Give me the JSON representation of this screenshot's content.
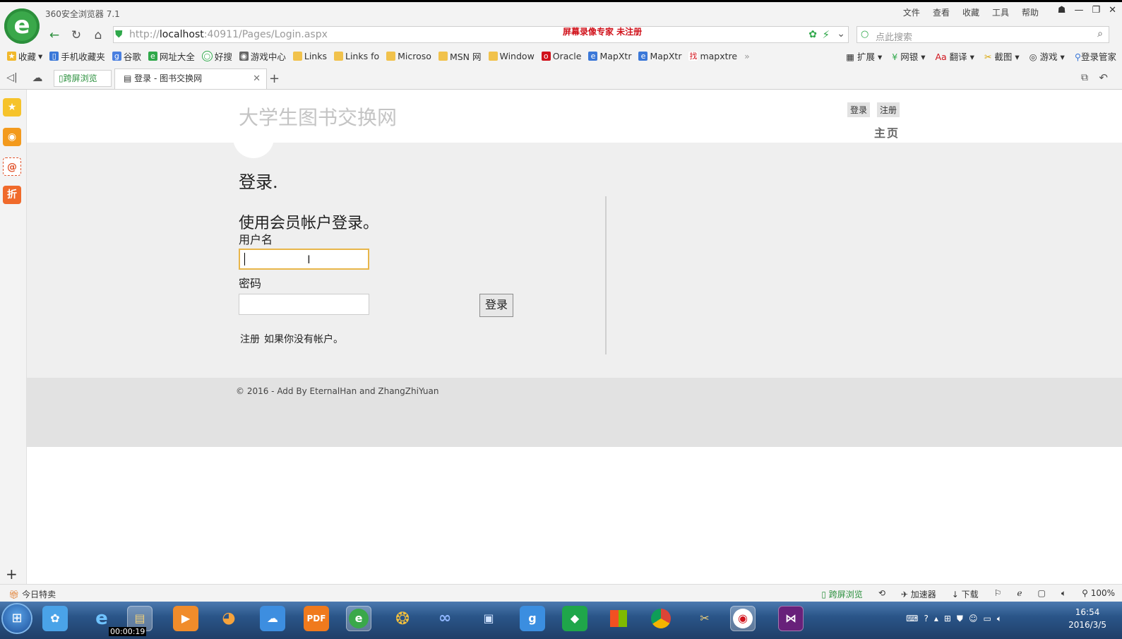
{
  "browser": {
    "app_title": "360安全浏览器 7.1",
    "menu": [
      "文件",
      "查看",
      "收藏",
      "工具",
      "帮助"
    ],
    "address": {
      "url_prefix": "http://",
      "url_host": "localhost",
      "url_rest": ":40911/Pages/Login.aspx",
      "watermark": "屏幕录像专家  未注册"
    },
    "search_placeholder": "点此搜索",
    "bookmarks": [
      "收藏",
      "手机收藏夹",
      "谷歌",
      "网址大全",
      "好搜",
      "游戏中心",
      "Links",
      "Links fo",
      "Microso",
      "MSN 网",
      "Window",
      "Oracle",
      "MapXtr",
      "MapXtr",
      "mapxtre"
    ],
    "toolbar_right": [
      "扩展",
      "网银",
      "翻译",
      "截图",
      "游戏",
      "登录管家"
    ],
    "tabs": [
      {
        "label": "跨屏浏览"
      },
      {
        "label": "登录 - 图书交换网"
      }
    ],
    "status_left": "今日特卖",
    "status_right": [
      "跨屏浏览",
      "加速器",
      "下载",
      "100%"
    ]
  },
  "page": {
    "site_title": "大学生图书交换网",
    "header_links": {
      "login": "登录",
      "register": "注册"
    },
    "nav_home": "主页",
    "heading": "登录.",
    "subheading": "使用会员帐户登录。",
    "username_label": "用户名",
    "password_label": "密码",
    "login_button": "登录",
    "register_link": "注册",
    "register_hint": "如果你没有帐户。",
    "footer": "© 2016 - Add By EternalHan and ZhangZhiYuan"
  },
  "taskbar": {
    "recording_timer": "00:00:19",
    "time": "16:54",
    "date": "2016/3/5"
  }
}
